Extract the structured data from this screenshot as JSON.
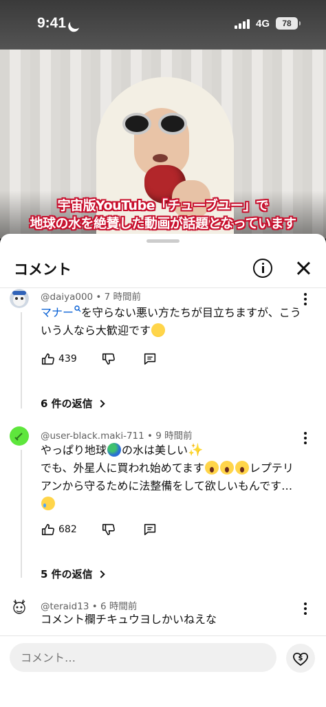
{
  "status_bar": {
    "time": "9:41",
    "network": "4G",
    "battery": "78"
  },
  "video": {
    "caption_line1": "宇宙版YouTube「チューブユー」で",
    "caption_line2": "地球の水を絶賛した動画が話題となっています"
  },
  "sheet": {
    "title": "コメント"
  },
  "comments": [
    {
      "handle": "@daiya000 • 7 時間前",
      "link_text": "マナー",
      "text_after_link": "を守らない悪い方たちが目立ちますが、こういう人なら大歓迎です",
      "likes": "439",
      "replies": "6 件の返信"
    },
    {
      "handle": "@user-black.maki-711 • 9 時間前",
      "line1_a": "やっぱり地球",
      "line1_b": "の水は美しい",
      "line2": "でも、外星人に買われ始めてます",
      "line2_b": "レプテリアンから守るために法整備をして欲しいもんです…",
      "likes": "682",
      "replies": "5 件の返信"
    },
    {
      "handle": "@teraid13 • 6 時間前",
      "text": "コメント欄チキュウヨしかいねえな"
    }
  ],
  "input": {
    "placeholder": "コメント…"
  },
  "colors": {
    "link": "#065fd4",
    "caption_outline": "#c8102e"
  }
}
